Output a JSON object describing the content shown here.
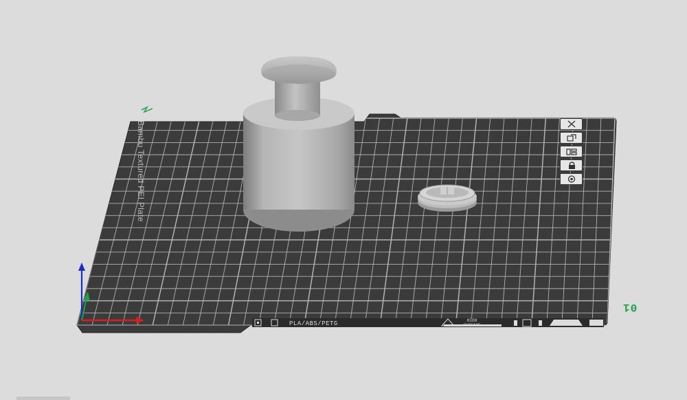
{
  "viewport": {
    "background_color": "#dcdcdc",
    "bed": {
      "name": "Bambu Textured PEI Plate",
      "filament_label": "PLA/ABS/PETG",
      "surface_label_line1": "HIGH",
      "surface_label_line2": "SURFACE",
      "plate_color": "#3b3b3b",
      "grid_color": "#c9c9c9"
    },
    "plate_number": "01",
    "plate_tools": [
      {
        "name": "delete-plate",
        "icon": "close-icon"
      },
      {
        "name": "orient-plate",
        "icon": "orient-icon"
      },
      {
        "name": "arrange-plate",
        "icon": "arrange-icon"
      },
      {
        "name": "lock-plate",
        "icon": "lock-icon"
      },
      {
        "name": "plate-settings",
        "icon": "settings-icon"
      }
    ],
    "axes": {
      "x_color": "#d62020",
      "y_color": "#1ea044",
      "z_color": "#1c2fc4"
    },
    "objects": [
      {
        "name": "weight-knob-model",
        "color": "#b4b4b4"
      },
      {
        "name": "lid-ring-model",
        "color": "#bdbdbd"
      }
    ]
  }
}
